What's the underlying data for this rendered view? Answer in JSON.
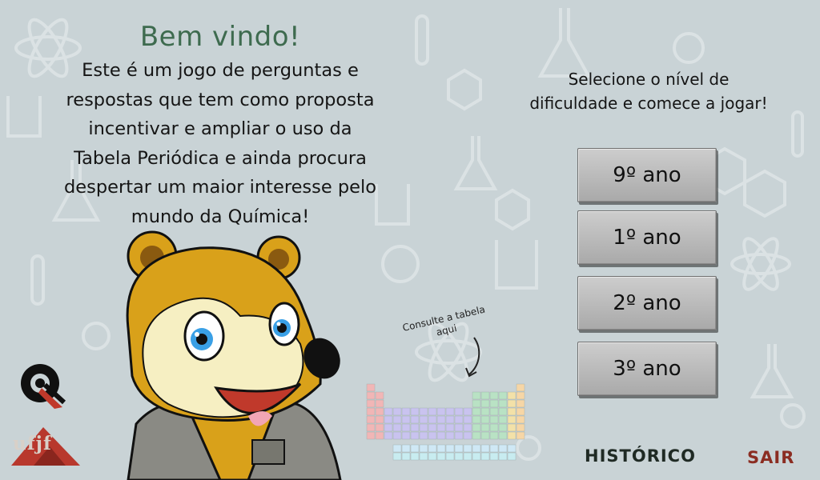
{
  "welcome": {
    "title": "Bem vindo!",
    "description_lines": [
      "Este é um jogo de perguntas e",
      "respostas que tem como proposta",
      "incentivar e ampliar o uso da",
      "Tabela Periódica e ainda procura",
      "despertar um maior interesse pelo",
      "mundo da Química!"
    ]
  },
  "level_select": {
    "prompt_lines": [
      "Selecione o nível de",
      "dificuldade e comece a jogar!"
    ],
    "levels": [
      {
        "label": "9º ano"
      },
      {
        "label": "1º ano"
      },
      {
        "label": "2º ano"
      },
      {
        "label": "3º ano"
      }
    ]
  },
  "periodic_table_hint": {
    "lines": [
      "Consulte a tabela",
      "aqui"
    ]
  },
  "footer": {
    "history_label": "HISTÓRICO",
    "exit_label": "SAIR"
  },
  "logos": {
    "university_text": "ufjf"
  },
  "colors": {
    "background": "#c9d3d6",
    "title_green": "#3e6b4f",
    "exit_red": "#8b2d22",
    "history_dark": "#1f2a24",
    "button_gray": "#bdbdbd"
  },
  "icons": [
    "chemistry-doodle-background",
    "bear-mascot",
    "periodic-table-thumbnail",
    "curved-arrow-icon",
    "q-logo",
    "ufjf-logo"
  ]
}
